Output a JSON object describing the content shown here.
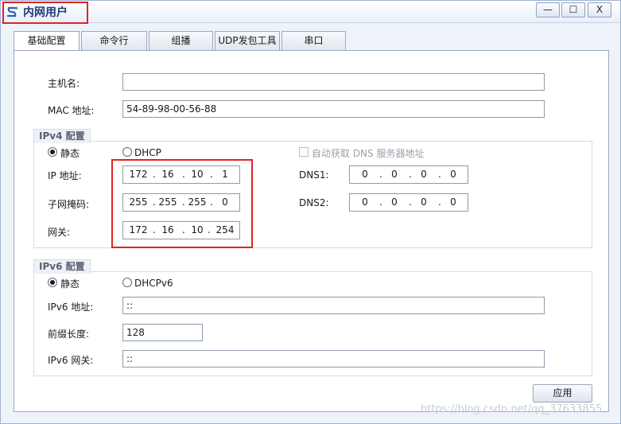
{
  "window": {
    "title": "内网用户",
    "minimize_label": "—",
    "maximize_label": "☐",
    "close_label": "X"
  },
  "tabs": [
    {
      "label": "基础配置",
      "active": true
    },
    {
      "label": "命令行",
      "active": false
    },
    {
      "label": "组播",
      "active": false
    },
    {
      "label": "UDP发包工具",
      "active": false
    },
    {
      "label": "串口",
      "active": false
    }
  ],
  "basic": {
    "hostname_label": "主机名:",
    "hostname_value": "",
    "mac_label": "MAC 地址:",
    "mac_value": "54-89-98-00-56-88"
  },
  "ipv4": {
    "group_title": "IPv4 配置",
    "static_label": "静态",
    "dhcp_label": "DHCP",
    "mode": "static",
    "auto_dns_label": "自动获取 DNS 服务器地址",
    "ip_label": "IP 地址:",
    "ip": [
      "172",
      "16",
      "10",
      "1"
    ],
    "mask_label": "子网掩码:",
    "mask": [
      "255",
      "255",
      "255",
      "0"
    ],
    "gateway_label": "网关:",
    "gateway": [
      "172",
      "16",
      "10",
      "254"
    ],
    "dns1_label": "DNS1:",
    "dns1": [
      "0",
      "0",
      "0",
      "0"
    ],
    "dns2_label": "DNS2:",
    "dns2": [
      "0",
      "0",
      "0",
      "0"
    ]
  },
  "ipv6": {
    "group_title": "IPv6 配置",
    "static_label": "静态",
    "dhcp_label": "DHCPv6",
    "mode": "static",
    "ip_label": "IPv6 地址:",
    "ip_value": "::",
    "prefix_label": "前缀长度:",
    "prefix_value": "128",
    "gateway_label": "IPv6 网关:",
    "gateway_value": "::"
  },
  "apply_label": "应用",
  "watermark": "https://blog.csdn.net/qq_37633855",
  "colors": {
    "highlight": "#e02424",
    "title_text": "#1b3d7a"
  }
}
